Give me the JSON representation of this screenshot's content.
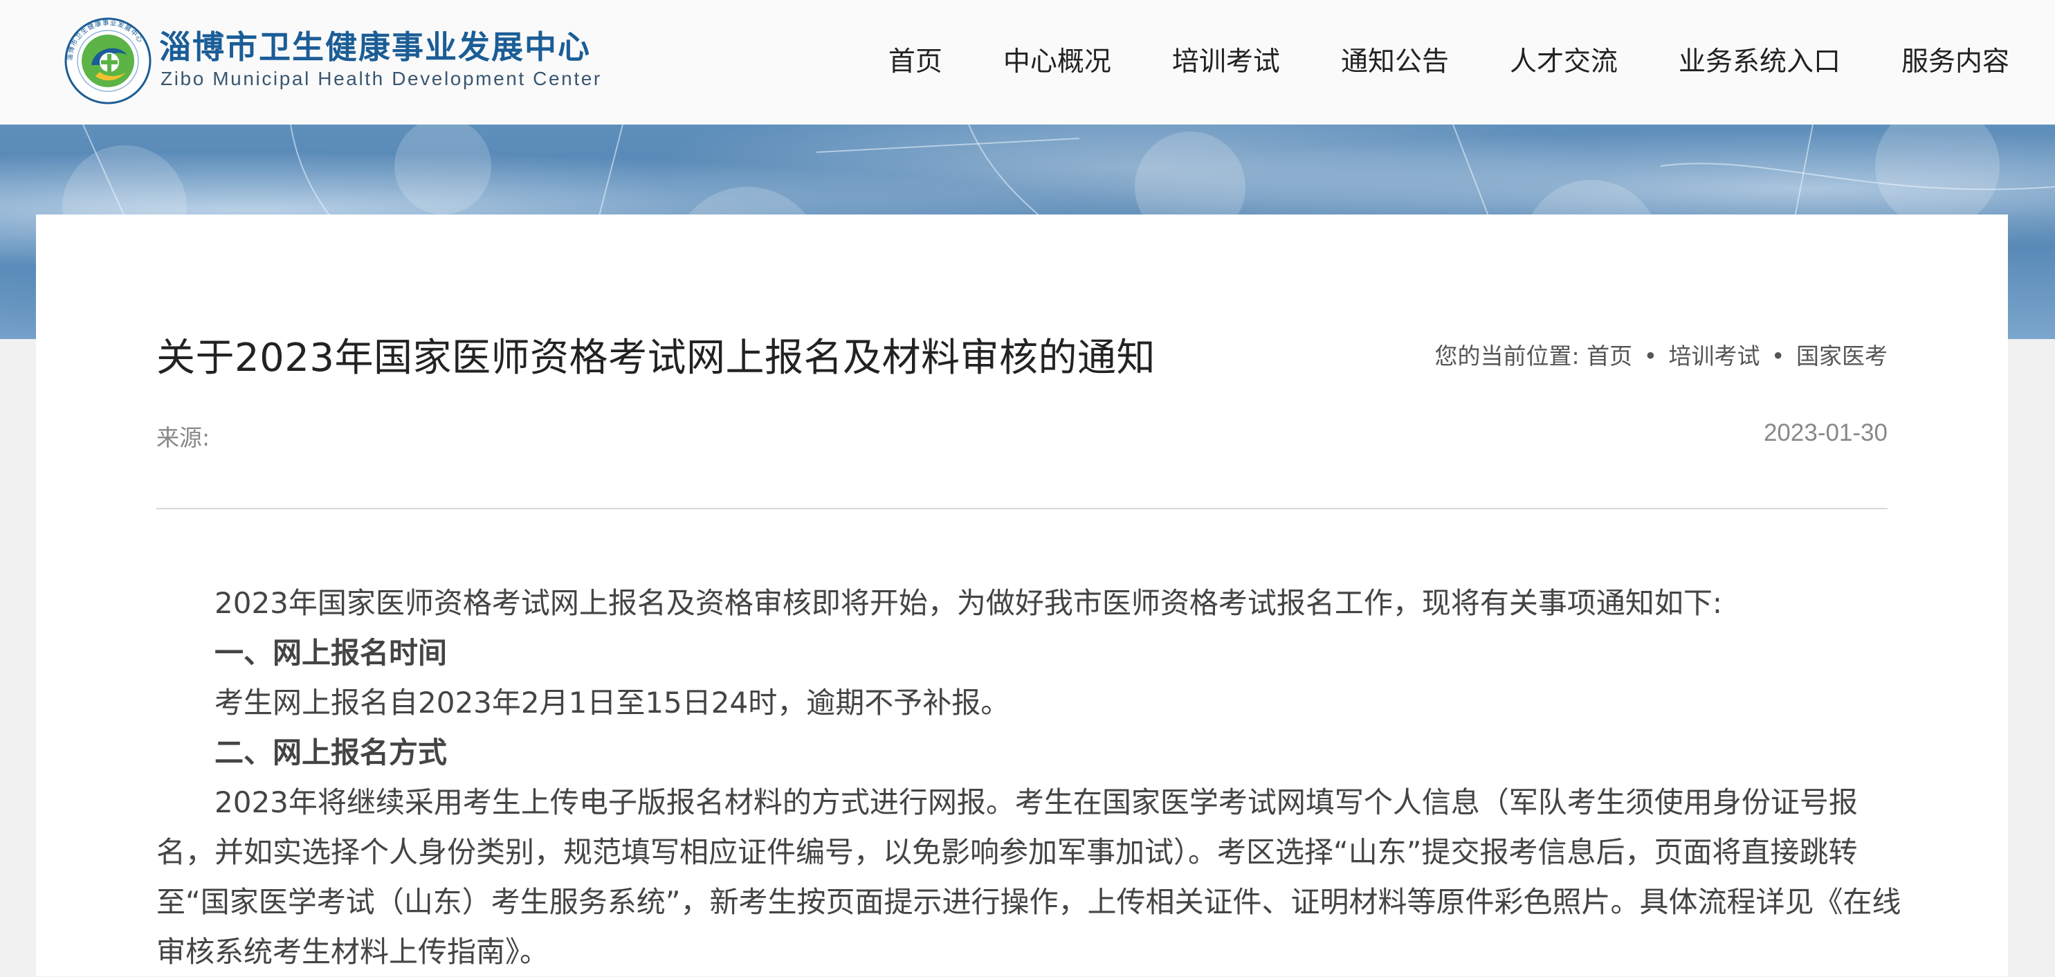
{
  "header": {
    "logo_cn": "淄博市卫生健康事业发展中心",
    "logo_en": "Zibo Municipal Health Development Center",
    "logo_ring_text": "淄博市卫生健康事业发展中心"
  },
  "nav": {
    "items": [
      {
        "label": "首页"
      },
      {
        "label": "中心概况"
      },
      {
        "label": "培训考试"
      },
      {
        "label": "通知公告"
      },
      {
        "label": "人才交流"
      },
      {
        "label": "业务系统入口"
      },
      {
        "label": "服务内容"
      }
    ]
  },
  "article": {
    "title": "关于2023年国家医师资格考试网上报名及材料审核的通知",
    "breadcrumb_prefix": "您的当前位置:",
    "breadcrumb": [
      "首页",
      "培训考试",
      "国家医考"
    ],
    "breadcrumb_sep": "•",
    "source_label": "来源:",
    "date": "2023-01-30",
    "intro": "2023年国家医师资格考试网上报名及资格审核即将开始，为做好我市医师资格考试报名工作，现将有关事项通知如下:",
    "section1_heading": "一、网上报名时间",
    "section1_body": "考生网上报名自2023年2月1日至15日24时，逾期不予补报。",
    "section2_heading": "二、网上报名方式",
    "section2_body": "2023年将继续采用考生上传电子版报名材料的方式进行网报。考生在国家医学考试网填写个人信息（军队考生须使用身份证号报名，并如实选择个人身份类别，规范填写相应证件编号，以免影响参加军事加试）。考区选择“山东”提交报考信息后，页面将直接跳转至“国家医学考试（山东）考生服务系统”，新考生按页面提示进行操作，上传相关证件、证明材料等原件彩色照片。具体流程详见《在线审核系统考生材料上传指南》。"
  },
  "colors": {
    "brand_blue": "#1b5d96",
    "logo_green": "#5bb445",
    "banner_blue": "#4f82b1"
  }
}
